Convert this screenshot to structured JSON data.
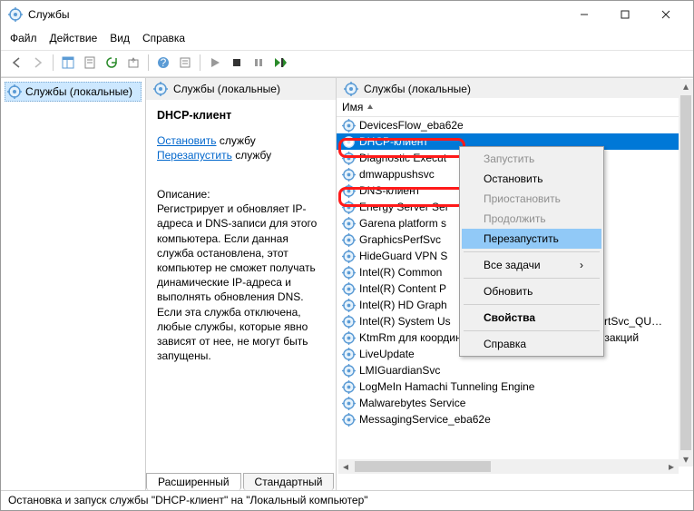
{
  "window": {
    "title": "Службы"
  },
  "menu": {
    "file": "Файл",
    "action": "Действие",
    "view": "Вид",
    "help": "Справка"
  },
  "tree": {
    "root": "Службы (локальные)"
  },
  "mid": {
    "header": "Службы (локальные)",
    "selected": "DHCP-клиент",
    "stop_link": "Остановить",
    "stop_sfx": " службу",
    "restart_link": "Перезапустить",
    "restart_sfx": " службу",
    "desc_label": "Описание:",
    "desc": "Регистрирует и обновляет IP-адреса и DNS-записи для этого компьютера. Если данная служба остановлена, этот компьютер не сможет получать динамические IP-адреса и выполнять обновления DNS. Если эта служба отключена, любые службы, которые явно зависят от нее, не могут быть запущены."
  },
  "list": {
    "col": "Имя",
    "items": [
      {
        "name": "DevicesFlow_eba62e"
      },
      {
        "name": "DHCP-клиент",
        "selected": true,
        "hl": true
      },
      {
        "name": "Diagnostic Execut"
      },
      {
        "name": "dmwappushsvc"
      },
      {
        "name": "DNS-клиент",
        "hl": true
      },
      {
        "name": "Energy Server Ser"
      },
      {
        "name": "Garena platform s"
      },
      {
        "name": "GraphicsPerfSvc"
      },
      {
        "name": "HideGuard VPN S"
      },
      {
        "name": "Intel(R) Common"
      },
      {
        "name": "Intel(R) Content P"
      },
      {
        "name": "Intel(R) HD Graph"
      },
      {
        "name": "Intel(R) System Us",
        "extra": "ReportSvc_QU…"
      },
      {
        "name": "KtmRm для координатора распределенных транзакций"
      },
      {
        "name": "LiveUpdate"
      },
      {
        "name": "LMIGuardianSvc"
      },
      {
        "name": "LogMeIn Hamachi Tunneling Engine"
      },
      {
        "name": "Malwarebytes Service"
      },
      {
        "name": "MessagingService_eba62e"
      }
    ]
  },
  "ctx": {
    "start": "Запустить",
    "stop": "Остановить",
    "pause": "Приостановить",
    "resume": "Продолжить",
    "restart": "Перезапустить",
    "all": "Все задачи",
    "refresh": "Обновить",
    "props": "Свойства",
    "help": "Справка"
  },
  "tabs": {
    "ext": "Расширенный",
    "std": "Стандартный"
  },
  "status": "Остановка и запуск службы \"DHCP-клиент\" на \"Локальный компьютер\""
}
